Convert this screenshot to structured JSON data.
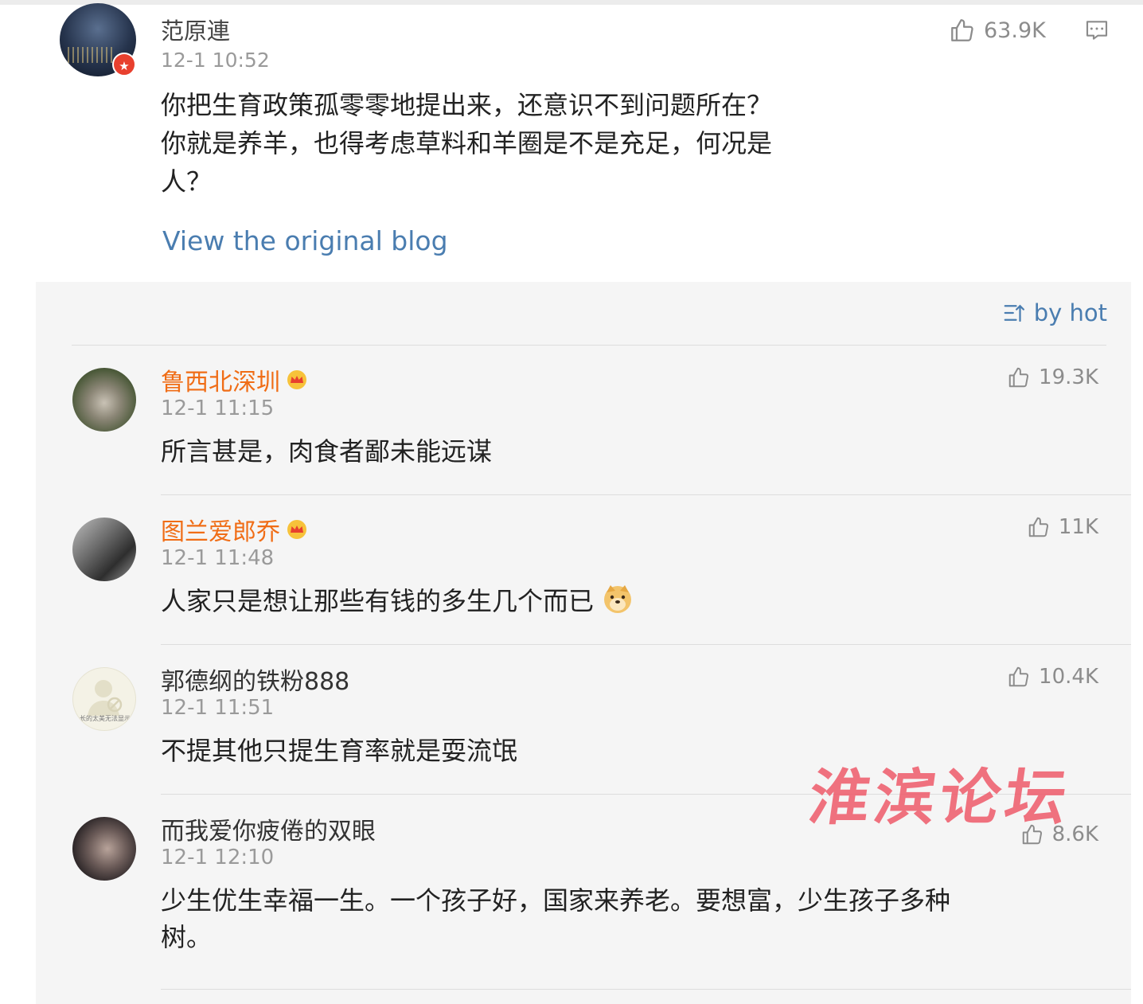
{
  "post": {
    "author": "范原連",
    "time": "12-1 10:52",
    "text_lines": [
      "你把生育政策孤零零地提出来，还意识不到问题所在？",
      "你就是养羊，也得考虑草料和羊圈是不是充足，何况是",
      "人？"
    ],
    "likes": "63.9K",
    "view_original": "View the original blog"
  },
  "sort_label": "by hot",
  "comments": [
    {
      "name": "鲁西北深圳",
      "time": "12-1 11:15",
      "text": "所言甚是，肉食者鄙未能远谋",
      "likes": "19.3K"
    },
    {
      "name": "图兰爱郎乔",
      "time": "12-1 11:48",
      "text": "人家只是想让那些有钱的多生几个而已",
      "likes": "11K"
    },
    {
      "name": "郭德纲的铁粉888",
      "time": "12-1 11:51",
      "text": "不提其他只提生育率就是耍流氓",
      "likes": "10.4K",
      "avatar_caption": "长的太美无法显示"
    },
    {
      "name": "而我爱你疲倦的双眼",
      "time": "12-1 12:10",
      "text_lines": [
        "少生优生幸福一生。一个孩子好，国家来养老。要想富，少生孩子多种",
        "树。"
      ],
      "likes": "8.6K"
    }
  ],
  "watermark": "淮滨论坛",
  "colors": {
    "vip_name": "#f06d16",
    "link": "#4a7db0",
    "watermark": "#ef5a6a"
  },
  "icons": [
    "thumbs-up-icon",
    "comment-icon",
    "sort-icon",
    "crown-icon",
    "verified-badge-icon",
    "doge-emoji"
  ]
}
